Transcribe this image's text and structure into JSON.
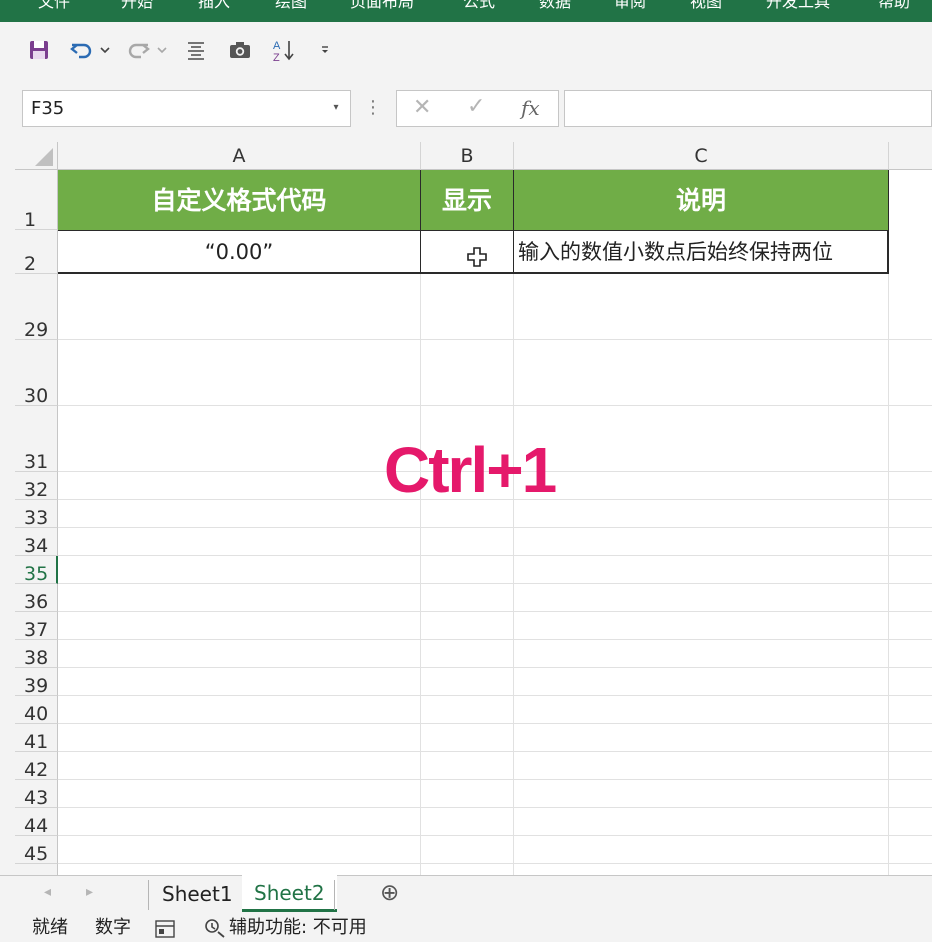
{
  "ribbon": {
    "tabs": [
      "文件",
      "开始",
      "插入",
      "绘图",
      "页面布局",
      "公式",
      "数据",
      "审阅",
      "视图",
      "开发工具",
      "帮助"
    ]
  },
  "namebox": {
    "value": "F35"
  },
  "formula": {
    "cancel_icon": "✕",
    "enter_icon": "✓",
    "fx_label": "fx",
    "value": ""
  },
  "columns": [
    "A",
    "B",
    "C"
  ],
  "rows": [
    "1",
    "2",
    "29",
    "30",
    "31",
    "32",
    "33",
    "34",
    "35",
    "36",
    "37",
    "38",
    "39",
    "40",
    "41",
    "42",
    "43",
    "44",
    "45"
  ],
  "table": {
    "headers": [
      "自定义格式代码",
      "显示",
      "说明"
    ],
    "row2": [
      "“0.00”",
      "",
      "输入的数值小数点后始终保持两位"
    ]
  },
  "overlay": {
    "text": "Ctrl+1",
    "color": "#e5196b"
  },
  "sheets": {
    "tabs": [
      "Sheet1",
      "Sheet2"
    ],
    "active": "Sheet2",
    "add_icon": "⊕"
  },
  "status": {
    "ready": "就绪",
    "mode": "数字",
    "accessibility": "辅助功能: 不可用"
  },
  "colors": {
    "accent": "#217346",
    "header_fill": "#70ad47"
  }
}
